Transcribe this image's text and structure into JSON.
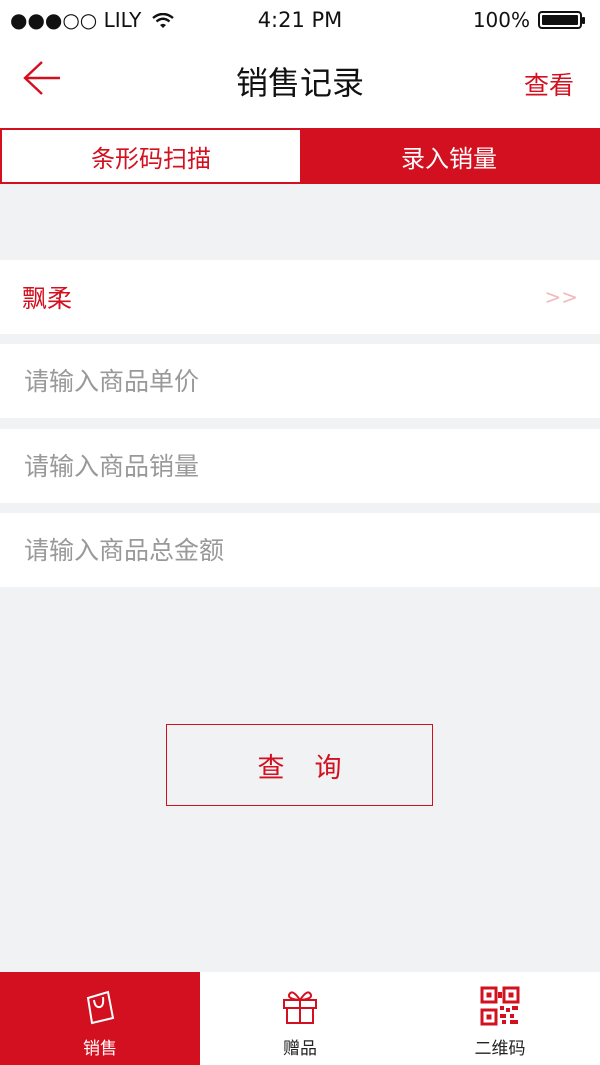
{
  "status_bar": {
    "carrier": "●●●○○ LILY",
    "time": "4:21 PM",
    "battery": "100%"
  },
  "nav": {
    "title": "销售记录",
    "view_label": "查看",
    "back_icon": "back-arrow-icon"
  },
  "segments": [
    {
      "label": "条形码扫描",
      "active": false
    },
    {
      "label": "录入销量",
      "active": true
    }
  ],
  "form": {
    "product": {
      "value": "飘柔",
      "arrow": ">>"
    },
    "unit_price_placeholder": "请输入商品单价",
    "quantity_placeholder": "请输入商品销量",
    "total_placeholder": "请输入商品总金额"
  },
  "query_button": "查询",
  "tabbar": [
    {
      "label": "销售",
      "icon": "shopping-bag-icon",
      "active": true
    },
    {
      "label": "赠品",
      "icon": "gift-icon",
      "active": false
    },
    {
      "label": "二维码",
      "icon": "qr-code-icon",
      "active": false
    }
  ],
  "colors": {
    "accent": "#d3101f",
    "background": "#f1f2f4"
  }
}
